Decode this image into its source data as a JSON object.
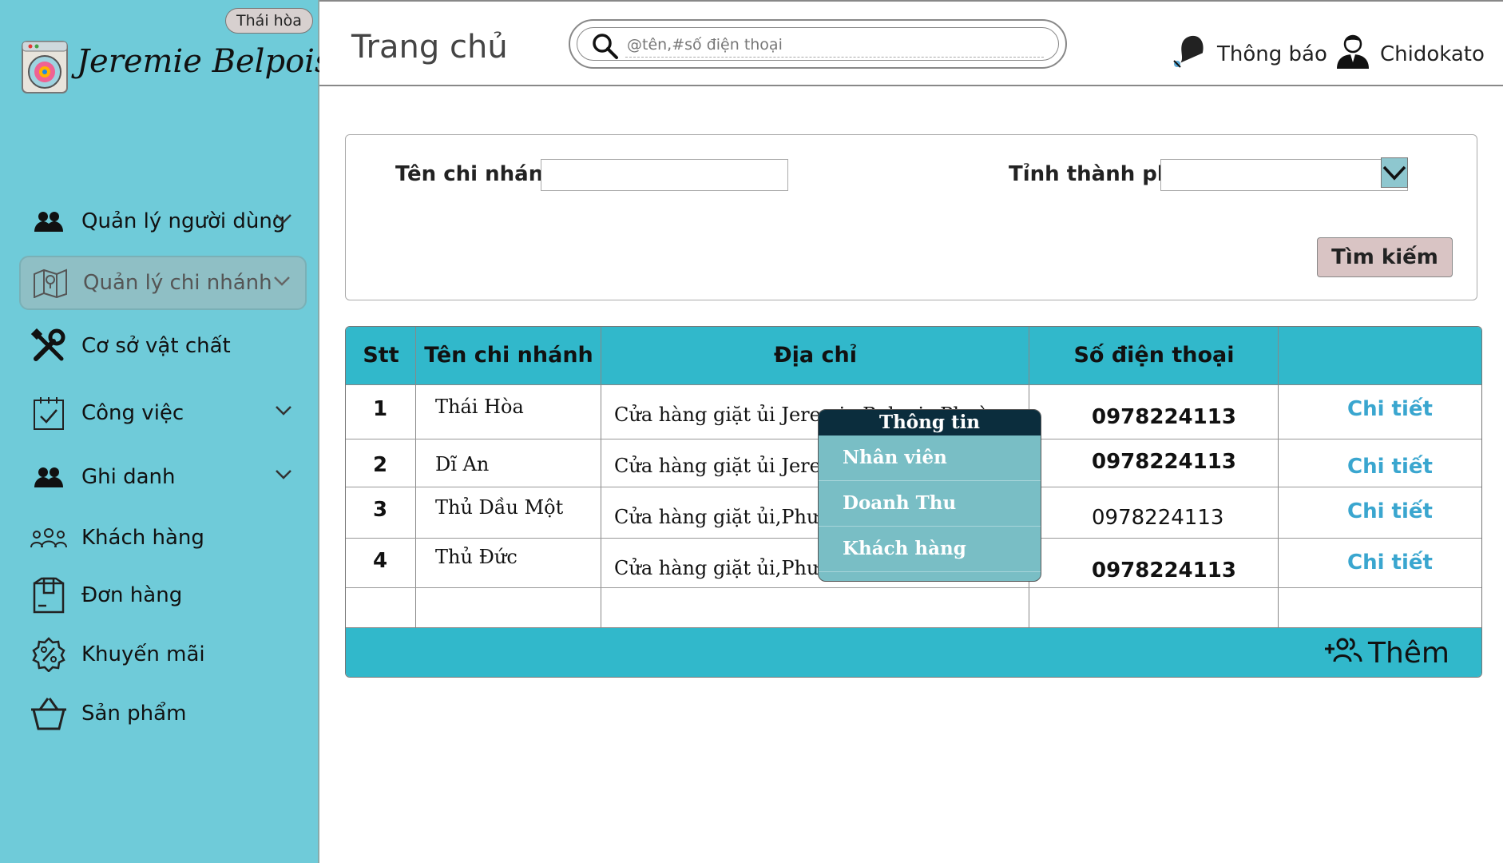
{
  "sidebar": {
    "branch_badge": "Thái hòa",
    "brand": "Jeremie Belpois",
    "items": [
      {
        "label": "Quản lý người dùng",
        "icon": "users-icon",
        "has_chevron": true
      },
      {
        "label": "Quản lý chi nhánh",
        "icon": "map-icon",
        "has_chevron": true,
        "active": true
      },
      {
        "label": "Cơ sở vật chất",
        "icon": "tools-icon",
        "has_chevron": false
      },
      {
        "label": "Công việc",
        "icon": "calendar-check-icon",
        "has_chevron": true
      },
      {
        "label": "Ghi danh",
        "icon": "users-icon",
        "has_chevron": true
      },
      {
        "label": "Khách hàng",
        "icon": "customers-icon",
        "has_chevron": false
      },
      {
        "label": "Đơn hàng",
        "icon": "package-icon",
        "has_chevron": false
      },
      {
        "label": "Khuyến mãi",
        "icon": "discount-badge-icon",
        "has_chevron": false
      },
      {
        "label": "Sản phẩm",
        "icon": "basket-icon",
        "has_chevron": false
      }
    ]
  },
  "header": {
    "title": "Trang chủ",
    "search_placeholder": "@tên,#số điện thoại",
    "notifications_label": "Thông báo",
    "user_name": "Chidokato"
  },
  "filter": {
    "branch_name_label": "Tên chi nhánh",
    "branch_name_value": "",
    "city_label": "Tỉnh thành phố",
    "city_value": "",
    "search_button": "Tìm kiếm"
  },
  "table": {
    "headers": [
      "Stt",
      "Tên chi nhánh",
      "Địa chỉ",
      "Số điện thoại",
      ""
    ],
    "rows": [
      {
        "stt": "1",
        "name": "Thái Hòa",
        "address": "Cửa hàng giặt ủi Jeremie Belpois Phườ",
        "phone": "0978224113",
        "action": "Chi tiết"
      },
      {
        "stt": "2",
        "name": "Dĩ An",
        "address": "Cửa hàng giặt ủi Jeremie",
        "phone": "0978224113",
        "action": "Chi tiết"
      },
      {
        "stt": "3",
        "name": "Thủ Dầu Một",
        "address": "Cửa hàng giặt ủi,Phường",
        "phone": "0978224113",
        "action": "Chi tiết"
      },
      {
        "stt": "4",
        "name": "Thủ Đức",
        "address": "Cửa hàng giặt ủi,Phường",
        "phone": "0978224113",
        "action": "Chi tiết"
      }
    ],
    "add_button": "Thêm"
  },
  "popup": {
    "title": "Thông tin",
    "items": [
      "Nhân viên",
      "Doanh Thu",
      "Khách hàng"
    ]
  },
  "colors": {
    "sidebar_bg": "#6fcbd9",
    "table_header_bg": "#31b8cb",
    "link": "#3aa6cf",
    "popup_bg": "#79bec5",
    "popup_title_bg": "#0b2d3d"
  }
}
